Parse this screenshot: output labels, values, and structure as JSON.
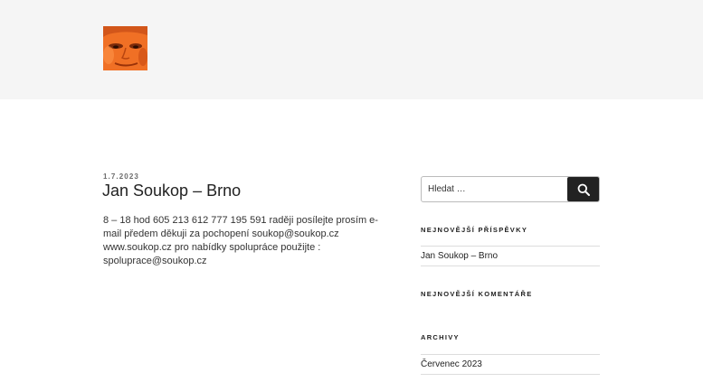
{
  "header": {
    "logo_alt": "Jan Soukop"
  },
  "post": {
    "date": "1.7.2023",
    "title": "Jan Soukop – Brno",
    "content": "8 – 18 hod 605 213 612 777 195 591 raději posílejte prosím e-mail předem děkuji za pochopení soukop@soukop.cz www.soukop.cz pro nabídky spolupráce použijte : spoluprace@soukop.cz"
  },
  "sidebar": {
    "search": {
      "placeholder": "Hledat …",
      "submit_icon": "search-icon"
    },
    "recent_posts": {
      "title": "NEJNOVĚJŠÍ PŘÍSPĚVKY",
      "items": [
        "Jan Soukop – Brno"
      ]
    },
    "recent_comments": {
      "title": "NEJNOVĚJŠÍ KOMENTÁŘE"
    },
    "archives": {
      "title": "ARCHIVY",
      "items": [
        "Červenec 2023"
      ]
    }
  },
  "colors": {
    "header_bg": "#f5f5f5",
    "button_bg": "#222222",
    "logo_orange": "#f16a1f"
  }
}
